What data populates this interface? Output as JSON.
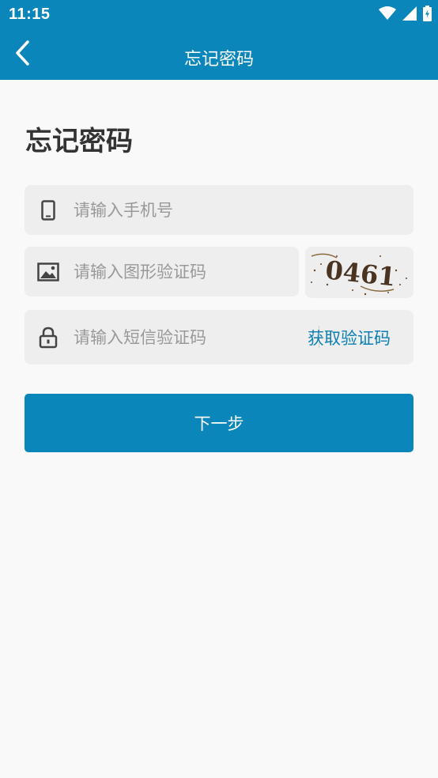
{
  "status_bar": {
    "time": "11:15",
    "icons": [
      "wifi-icon",
      "signal-icon",
      "battery-charging-icon"
    ]
  },
  "app_bar": {
    "title": "忘记密码",
    "back_icon": "chevron-left-icon"
  },
  "page": {
    "title": "忘记密码"
  },
  "form": {
    "phone": {
      "placeholder": "请输入手机号",
      "value": "",
      "icon": "phone-icon"
    },
    "image_captcha": {
      "placeholder": "请输入图形验证码",
      "value": "",
      "icon": "image-icon",
      "captcha_text": "0461"
    },
    "sms_code": {
      "placeholder": "请输入短信验证码",
      "value": "",
      "icon": "lock-icon",
      "get_code_label": "获取验证码"
    },
    "next_label": "下一步"
  },
  "colors": {
    "primary": "#0b86ba",
    "link": "#0b7fb4",
    "field_bg": "#eeeeee",
    "page_bg": "#f9f9f9"
  }
}
